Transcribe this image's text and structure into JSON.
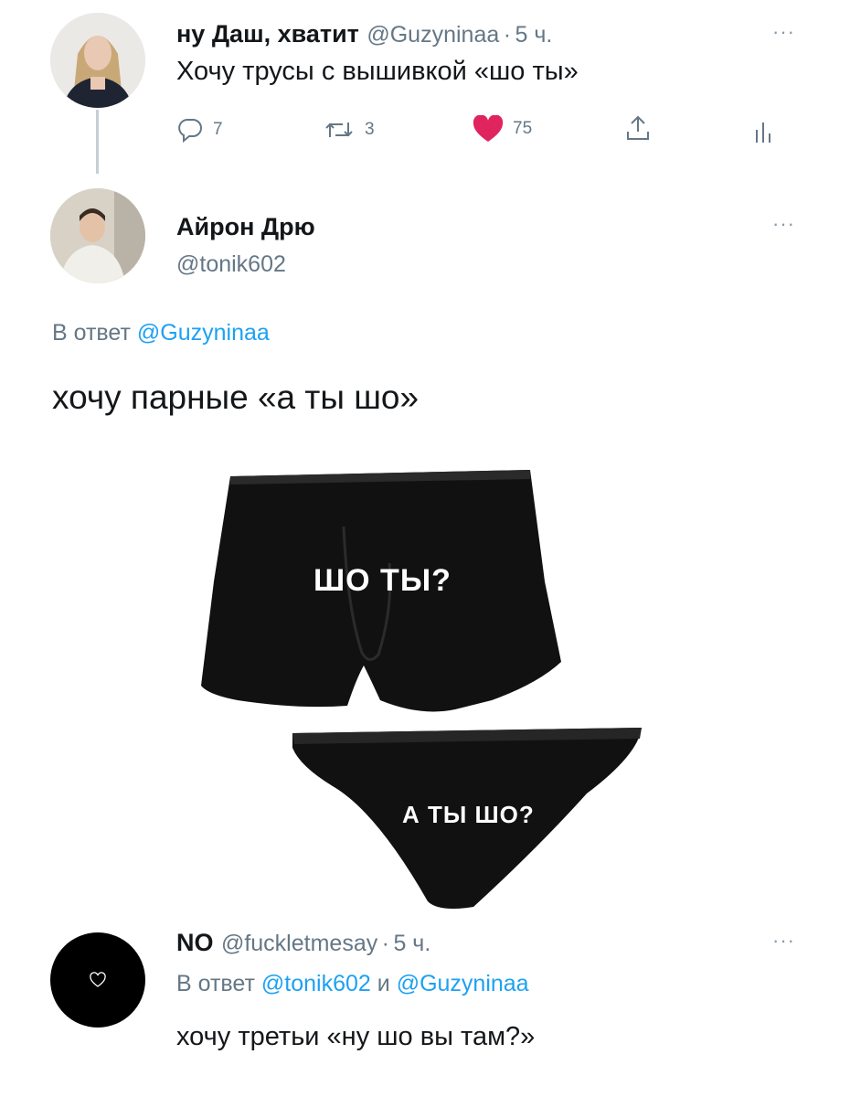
{
  "tweet1": {
    "display_name": "ну Даш, хватит",
    "handle": "@Guzyninaa",
    "separator": "·",
    "time": "5 ч.",
    "text": "Хочу трусы с вышивкой «шо ты»",
    "actions": {
      "replies": "7",
      "retweets": "3",
      "likes": "75"
    },
    "more": "···"
  },
  "tweet2": {
    "display_name": "Айрон Дрю",
    "handle": "@tonik602",
    "reply_prefix": "В ответ",
    "reply_to": "@Guzyninaa",
    "text": "хочу парные «а ты шо»",
    "more": "···",
    "image": {
      "boxer_text": "ШО ТЫ?",
      "brief_text": "А ТЫ ШО?"
    }
  },
  "tweet3": {
    "display_name": "NO",
    "handle": "@fuckletmesay",
    "separator": "·",
    "time": "5 ч.",
    "reply_prefix": "В ответ",
    "reply_to_1": "@tonik602",
    "reply_and": "и",
    "reply_to_2": "@Guzyninaa",
    "text": "хочу третьи «ну шо вы там?»",
    "more": "···"
  },
  "colors": {
    "like": "#e0245e",
    "link": "#1da1f2",
    "muted": "#657786"
  }
}
